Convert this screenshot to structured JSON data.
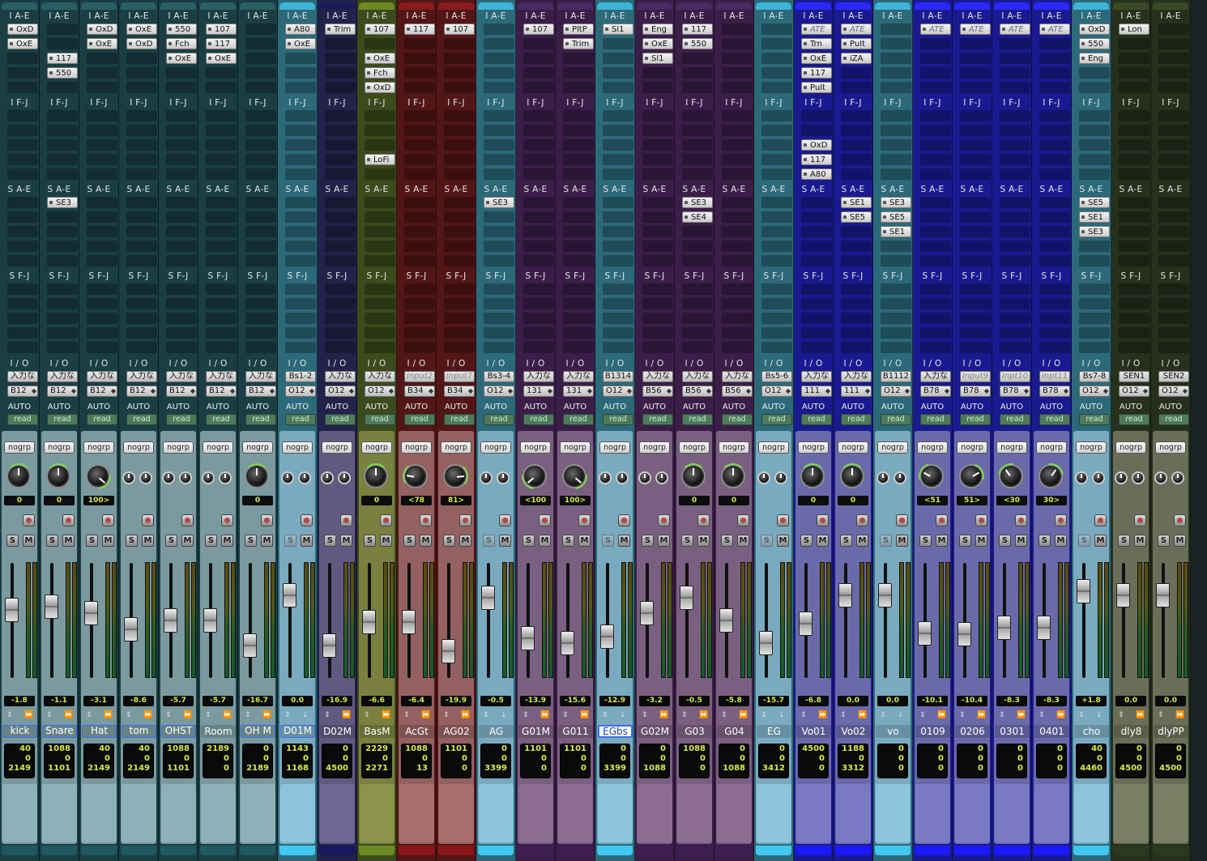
{
  "section_labels": {
    "inserts_ae": "I A-E",
    "inserts_fj": "I F-J",
    "sends_ae": "S A-E",
    "sends_fj": "S F-J",
    "io": "I / O",
    "auto": "AUTO"
  },
  "automation_mode": "read",
  "group_label": "nogrp",
  "colors": {
    "teal_dark": "#1e4f55",
    "teal_light": "#3a8ea2",
    "navy": "#2a2a6a",
    "olive": "#5a6a22",
    "red": "#6a1e1e",
    "purple": "#4a2a5a",
    "blue": "#2020c8",
    "green_dark": "#2e3a22",
    "selected_name": "#3b6cf0",
    "meter_value": "#d8e94a"
  },
  "tracks": [
    {
      "name": "kick",
      "color": "teal_dark",
      "inserts_ae": [
        "OxD",
        "OxE"
      ],
      "inserts_fj": [],
      "sends_ae": [],
      "input": "入力な",
      "output": "B12",
      "pan": "0",
      "knob": "mono",
      "pan_angle": 0,
      "fader": "-1.8",
      "fader_pos": 0.62,
      "counter": [
        "40",
        "0",
        "2149"
      ],
      "selected": true
    },
    {
      "name": "Snare",
      "color": "teal_dark",
      "inserts_ae": [
        "",
        "",
        "117",
        "550"
      ],
      "inserts_fj": [],
      "sends_ae": [
        "SE3"
      ],
      "input": "入力な",
      "output": "B12",
      "pan": "0",
      "knob": "mono",
      "pan_angle": 0,
      "fader": "-1.1",
      "fader_pos": 0.65,
      "counter": [
        "1088",
        "0",
        "1101"
      ],
      "selected": true
    },
    {
      "name": "Hat",
      "color": "teal_dark",
      "inserts_ae": [
        "OxD",
        "OxE"
      ],
      "inserts_fj": [],
      "sends_ae": [],
      "input": "入力な",
      "output": "B12",
      "pan": "100>",
      "knob": "mono",
      "pan_angle": 130,
      "fader": "-3.1",
      "fader_pos": 0.58,
      "counter": [
        "40",
        "0",
        "2149"
      ],
      "selected": true
    },
    {
      "name": "tom",
      "color": "teal_dark",
      "inserts_ae": [
        "OxE",
        "OxD"
      ],
      "inserts_fj": [],
      "sends_ae": [],
      "input": "入力な",
      "output": "B12",
      "pan": "",
      "knob": "stereo",
      "pan_angle": 0,
      "fader": "-8.6",
      "fader_pos": 0.4,
      "counter": [
        "40",
        "0",
        "2149"
      ],
      "selected": true
    },
    {
      "name": "OHST",
      "color": "teal_dark",
      "inserts_ae": [
        "550",
        "Fch",
        "OxE"
      ],
      "inserts_fj": [],
      "sends_ae": [],
      "input": "入力な",
      "output": "B12",
      "pan": "",
      "knob": "stereo",
      "pan_angle": 0,
      "fader": "-5.7",
      "fader_pos": 0.5,
      "counter": [
        "1088",
        "0",
        "1101"
      ],
      "selected": true
    },
    {
      "name": "Room",
      "color": "teal_dark",
      "inserts_ae": [
        "107",
        "117",
        "OxE"
      ],
      "inserts_fj": [],
      "sends_ae": [],
      "input": "入力な",
      "output": "B12",
      "pan": "",
      "knob": "stereo",
      "pan_angle": 0,
      "fader": "-5.7",
      "fader_pos": 0.5,
      "counter": [
        "2189",
        "0",
        "0"
      ],
      "selected": false
    },
    {
      "name": "OH M",
      "color": "teal_dark",
      "inserts_ae": [],
      "inserts_fj": [],
      "sends_ae": [],
      "input": "入力な",
      "output": "B12",
      "pan": "0",
      "knob": "mono",
      "pan_angle": 0,
      "fader": "-16.7",
      "fader_pos": 0.22,
      "counter": [
        "0",
        "0",
        "2189"
      ],
      "selected": true
    },
    {
      "name": "D01M",
      "color": "teal_light",
      "inserts_ae": [
        "A80",
        "OxE"
      ],
      "inserts_fj": [],
      "sends_ae": [],
      "input": "Bs1-2",
      "output": "O12",
      "pan": "",
      "knob": "stereo",
      "pan_angle": 0,
      "fader": "0.0",
      "fader_pos": 0.78,
      "counter": [
        "1143",
        "0",
        "1168"
      ],
      "selected": true
    },
    {
      "name": "D02M",
      "color": "navy",
      "inserts_ae": [
        "Trim"
      ],
      "inserts_fj": [],
      "sends_ae": [],
      "input": "入力な",
      "output": "O12",
      "pan": "",
      "knob": "stereo",
      "pan_angle": 0,
      "fader": "-16.9",
      "fader_pos": 0.22,
      "counter": [
        "0",
        "0",
        "4500"
      ],
      "selected": false
    },
    {
      "name": "BasM",
      "color": "olive",
      "inserts_ae": [
        "107",
        "",
        "OxE",
        "Fch",
        "OxD"
      ],
      "inserts_fj": [
        "",
        "",
        "",
        "LoFi"
      ],
      "sends_ae": [],
      "input": "入力な",
      "output": "O12",
      "pan": "0",
      "knob": "mono",
      "pan_angle": 0,
      "fader": "-6.6",
      "fader_pos": 0.48,
      "counter": [
        "2229",
        "0",
        "2271"
      ],
      "selected": false
    },
    {
      "name": "AcGt",
      "color": "red",
      "inserts_ae": [
        "117"
      ],
      "inserts_fj": [],
      "sends_ae": [],
      "input": "Input2",
      "input_italic": true,
      "output": "B34",
      "pan": "<78",
      "knob": "mono",
      "pan_angle": -80,
      "fader": "-6.4",
      "fader_pos": 0.48,
      "counter": [
        "1088",
        "0",
        "13"
      ],
      "selected": false
    },
    {
      "name": "AG02",
      "color": "red",
      "inserts_ae": [
        "107"
      ],
      "inserts_fj": [],
      "sends_ae": [],
      "input": "Input7",
      "input_italic": true,
      "output": "B34",
      "pan": "81>",
      "knob": "mono",
      "pan_angle": 85,
      "fader": "-19.9",
      "fader_pos": 0.16,
      "counter": [
        "1101",
        "0",
        "0"
      ],
      "selected": false
    },
    {
      "name": "AG",
      "color": "teal_light",
      "inserts_ae": [],
      "inserts_fj": [],
      "sends_ae": [
        "SE3"
      ],
      "input": "Bs3-4",
      "output": "O12",
      "pan": "",
      "knob": "stereo",
      "pan_angle": 0,
      "fader": "-0.5",
      "fader_pos": 0.75,
      "counter": [
        "0",
        "0",
        "3399"
      ],
      "selected": false
    },
    {
      "name": "G01M",
      "color": "purple",
      "inserts_ae": [
        "107"
      ],
      "inserts_fj": [],
      "sends_ae": [],
      "input": "入力な",
      "output": "131",
      "pan": "<100",
      "knob": "mono",
      "pan_angle": -130,
      "fader": "-13.9",
      "fader_pos": 0.3,
      "counter": [
        "1101",
        "0",
        "0"
      ],
      "selected": false
    },
    {
      "name": "G011",
      "color": "purple",
      "inserts_ae": [
        "PltP",
        "Trim"
      ],
      "inserts_fj": [],
      "sends_ae": [],
      "input": "入力な",
      "output": "131",
      "pan": "100>",
      "knob": "mono",
      "pan_angle": 130,
      "fader": "-15.6",
      "fader_pos": 0.25,
      "counter": [
        "1101",
        "0",
        "0"
      ],
      "selected": false
    },
    {
      "name": "EGbs",
      "color": "teal_light",
      "inserts_ae": [
        "Sl1"
      ],
      "inserts_fj": [],
      "sends_ae": [],
      "input": "B1314",
      "output": "O12",
      "pan": "",
      "knob": "stereo",
      "pan_angle": 0,
      "fader": "-12.9",
      "fader_pos": 0.32,
      "counter": [
        "0",
        "0",
        "3399"
      ],
      "selected": false,
      "name_selected": true
    },
    {
      "name": "G02M",
      "color": "purple",
      "inserts_ae": [
        "Eng",
        "OxE",
        "Sl1"
      ],
      "inserts_fj": [],
      "sends_ae": [],
      "input": "入力な",
      "output": "B56",
      "pan": "",
      "knob": "stereo",
      "pan_angle": 0,
      "fader": "-3.2",
      "fader_pos": 0.58,
      "counter": [
        "0",
        "0",
        "1088"
      ],
      "selected": false
    },
    {
      "name": "G03",
      "color": "purple",
      "inserts_ae": [
        "117",
        "550"
      ],
      "inserts_fj": [],
      "sends_ae": [
        "SE3",
        "SE4"
      ],
      "input": "入力な",
      "output": "B56",
      "pan": "0",
      "knob": "mono",
      "pan_angle": 0,
      "fader": "-0.5",
      "fader_pos": 0.75,
      "counter": [
        "1088",
        "0",
        "0"
      ],
      "selected": false
    },
    {
      "name": "G04",
      "color": "purple",
      "inserts_ae": [],
      "inserts_fj": [],
      "sends_ae": [],
      "input": "入力な",
      "output": "B56",
      "pan": "0",
      "knob": "mono",
      "pan_angle": 0,
      "fader": "-5.8",
      "fader_pos": 0.5,
      "counter": [
        "0",
        "0",
        "1088"
      ],
      "selected": false
    },
    {
      "name": "EG",
      "color": "teal_light",
      "inserts_ae": [],
      "inserts_fj": [],
      "sends_ae": [],
      "input": "Bs5-6",
      "output": "O12",
      "pan": "",
      "knob": "stereo",
      "pan_angle": 0,
      "fader": "-15.7",
      "fader_pos": 0.25,
      "counter": [
        "0",
        "0",
        "3412"
      ],
      "selected": false
    },
    {
      "name": "Vo01",
      "color": "blue",
      "inserts_ae": [
        "ATE",
        "Trn",
        "OxE",
        "117",
        "Pult"
      ],
      "inserts_ae_inactive": [
        0
      ],
      "inserts_fj": [
        "",
        "",
        "OxD",
        "117",
        "A80"
      ],
      "sends_ae": [],
      "input": "入力な",
      "output": "111",
      "pan": "0",
      "knob": "mono",
      "pan_angle": 0,
      "fader": "-6.8",
      "fader_pos": 0.46,
      "counter": [
        "4500",
        "0",
        "0"
      ],
      "selected": false
    },
    {
      "name": "Vo02",
      "color": "blue",
      "inserts_ae": [
        "ATE",
        "Pult",
        "iZA"
      ],
      "inserts_ae_inactive": [
        0
      ],
      "inserts_fj": [],
      "sends_ae": [
        "SE1",
        "SE5"
      ],
      "input": "入力な",
      "output": "111",
      "pan": "0",
      "knob": "mono",
      "pan_angle": 0,
      "fader": "0.0",
      "fader_pos": 0.78,
      "counter": [
        "1188",
        "0",
        "3312"
      ],
      "selected": false
    },
    {
      "name": "vo",
      "color": "teal_light",
      "inserts_ae": [],
      "inserts_fj": [],
      "sends_ae": [
        "SE3",
        "SE5",
        "SE1"
      ],
      "input": "B1112",
      "output": "O12",
      "pan": "",
      "knob": "stereo",
      "pan_angle": 0,
      "fader": "0.0",
      "fader_pos": 0.78,
      "counter": [
        "0",
        "0",
        "0"
      ],
      "selected": false
    },
    {
      "name": "0109",
      "color": "blue",
      "inserts_ae": [
        "ATE"
      ],
      "inserts_ae_inactive": [
        0
      ],
      "inserts_fj": [],
      "sends_ae": [],
      "input": "入力な",
      "output": "B78",
      "pan": "<51",
      "knob": "mono",
      "pan_angle": -60,
      "fader": "-10.1",
      "fader_pos": 0.36,
      "counter": [
        "0",
        "0",
        "0"
      ],
      "selected": false
    },
    {
      "name": "0206",
      "color": "blue",
      "inserts_ae": [
        "ATE"
      ],
      "inserts_ae_inactive": [
        0
      ],
      "inserts_fj": [],
      "sends_ae": [],
      "input": "Input9",
      "input_italic": true,
      "output": "B78",
      "pan": "51>",
      "knob": "mono",
      "pan_angle": 60,
      "fader": "-10.4",
      "fader_pos": 0.35,
      "counter": [
        "0",
        "0",
        "0"
      ],
      "selected": false
    },
    {
      "name": "0301",
      "color": "blue",
      "inserts_ae": [
        "ATE"
      ],
      "inserts_ae_inactive": [
        0
      ],
      "inserts_fj": [],
      "sends_ae": [],
      "input": "Inpt10",
      "input_italic": true,
      "output": "B78",
      "pan": "<30",
      "knob": "mono",
      "pan_angle": -35,
      "fader": "-8.3",
      "fader_pos": 0.42,
      "counter": [
        "0",
        "0",
        "0"
      ],
      "selected": false
    },
    {
      "name": "0401",
      "color": "blue",
      "inserts_ae": [
        "ATE"
      ],
      "inserts_ae_inactive": [
        0
      ],
      "inserts_fj": [],
      "sends_ae": [],
      "input": "Inpt11",
      "input_italic": true,
      "output": "B78",
      "pan": "30>",
      "knob": "mono",
      "pan_angle": 35,
      "fader": "-8.3",
      "fader_pos": 0.42,
      "counter": [
        "0",
        "0",
        "0"
      ],
      "selected": false
    },
    {
      "name": "cho",
      "color": "teal_light",
      "inserts_ae": [
        "OxD",
        "550",
        "Eng"
      ],
      "inserts_fj": [],
      "sends_ae": [
        "SE5",
        "SE1",
        "SE3"
      ],
      "input": "Bs7-8",
      "output": "O12",
      "pan": "",
      "knob": "stereo",
      "pan_angle": 0,
      "fader": "+1.8",
      "fader_pos": 0.82,
      "counter": [
        "40",
        "0",
        "4460"
      ],
      "selected": false
    },
    {
      "name": "dly8",
      "color": "green_dark",
      "inserts_ae": [
        "Lon"
      ],
      "inserts_fj": [],
      "sends_ae": [],
      "input": "SEN1",
      "output": "O12",
      "pan": "",
      "knob": "stereo",
      "pan_angle": 0,
      "fader": "0.0",
      "fader_pos": 0.78,
      "counter": [
        "0",
        "0",
        "4500"
      ],
      "selected": false
    },
    {
      "name": "dlyPP",
      "color": "green_dark",
      "inserts_ae": [],
      "inserts_fj": [],
      "sends_ae": [],
      "input": "SEN2",
      "output": "O12",
      "pan": "",
      "knob": "stereo",
      "pan_angle": 0,
      "fader": "0.0",
      "fader_pos": 0.78,
      "counter": [
        "0",
        "0",
        "4500"
      ],
      "selected": false
    }
  ]
}
